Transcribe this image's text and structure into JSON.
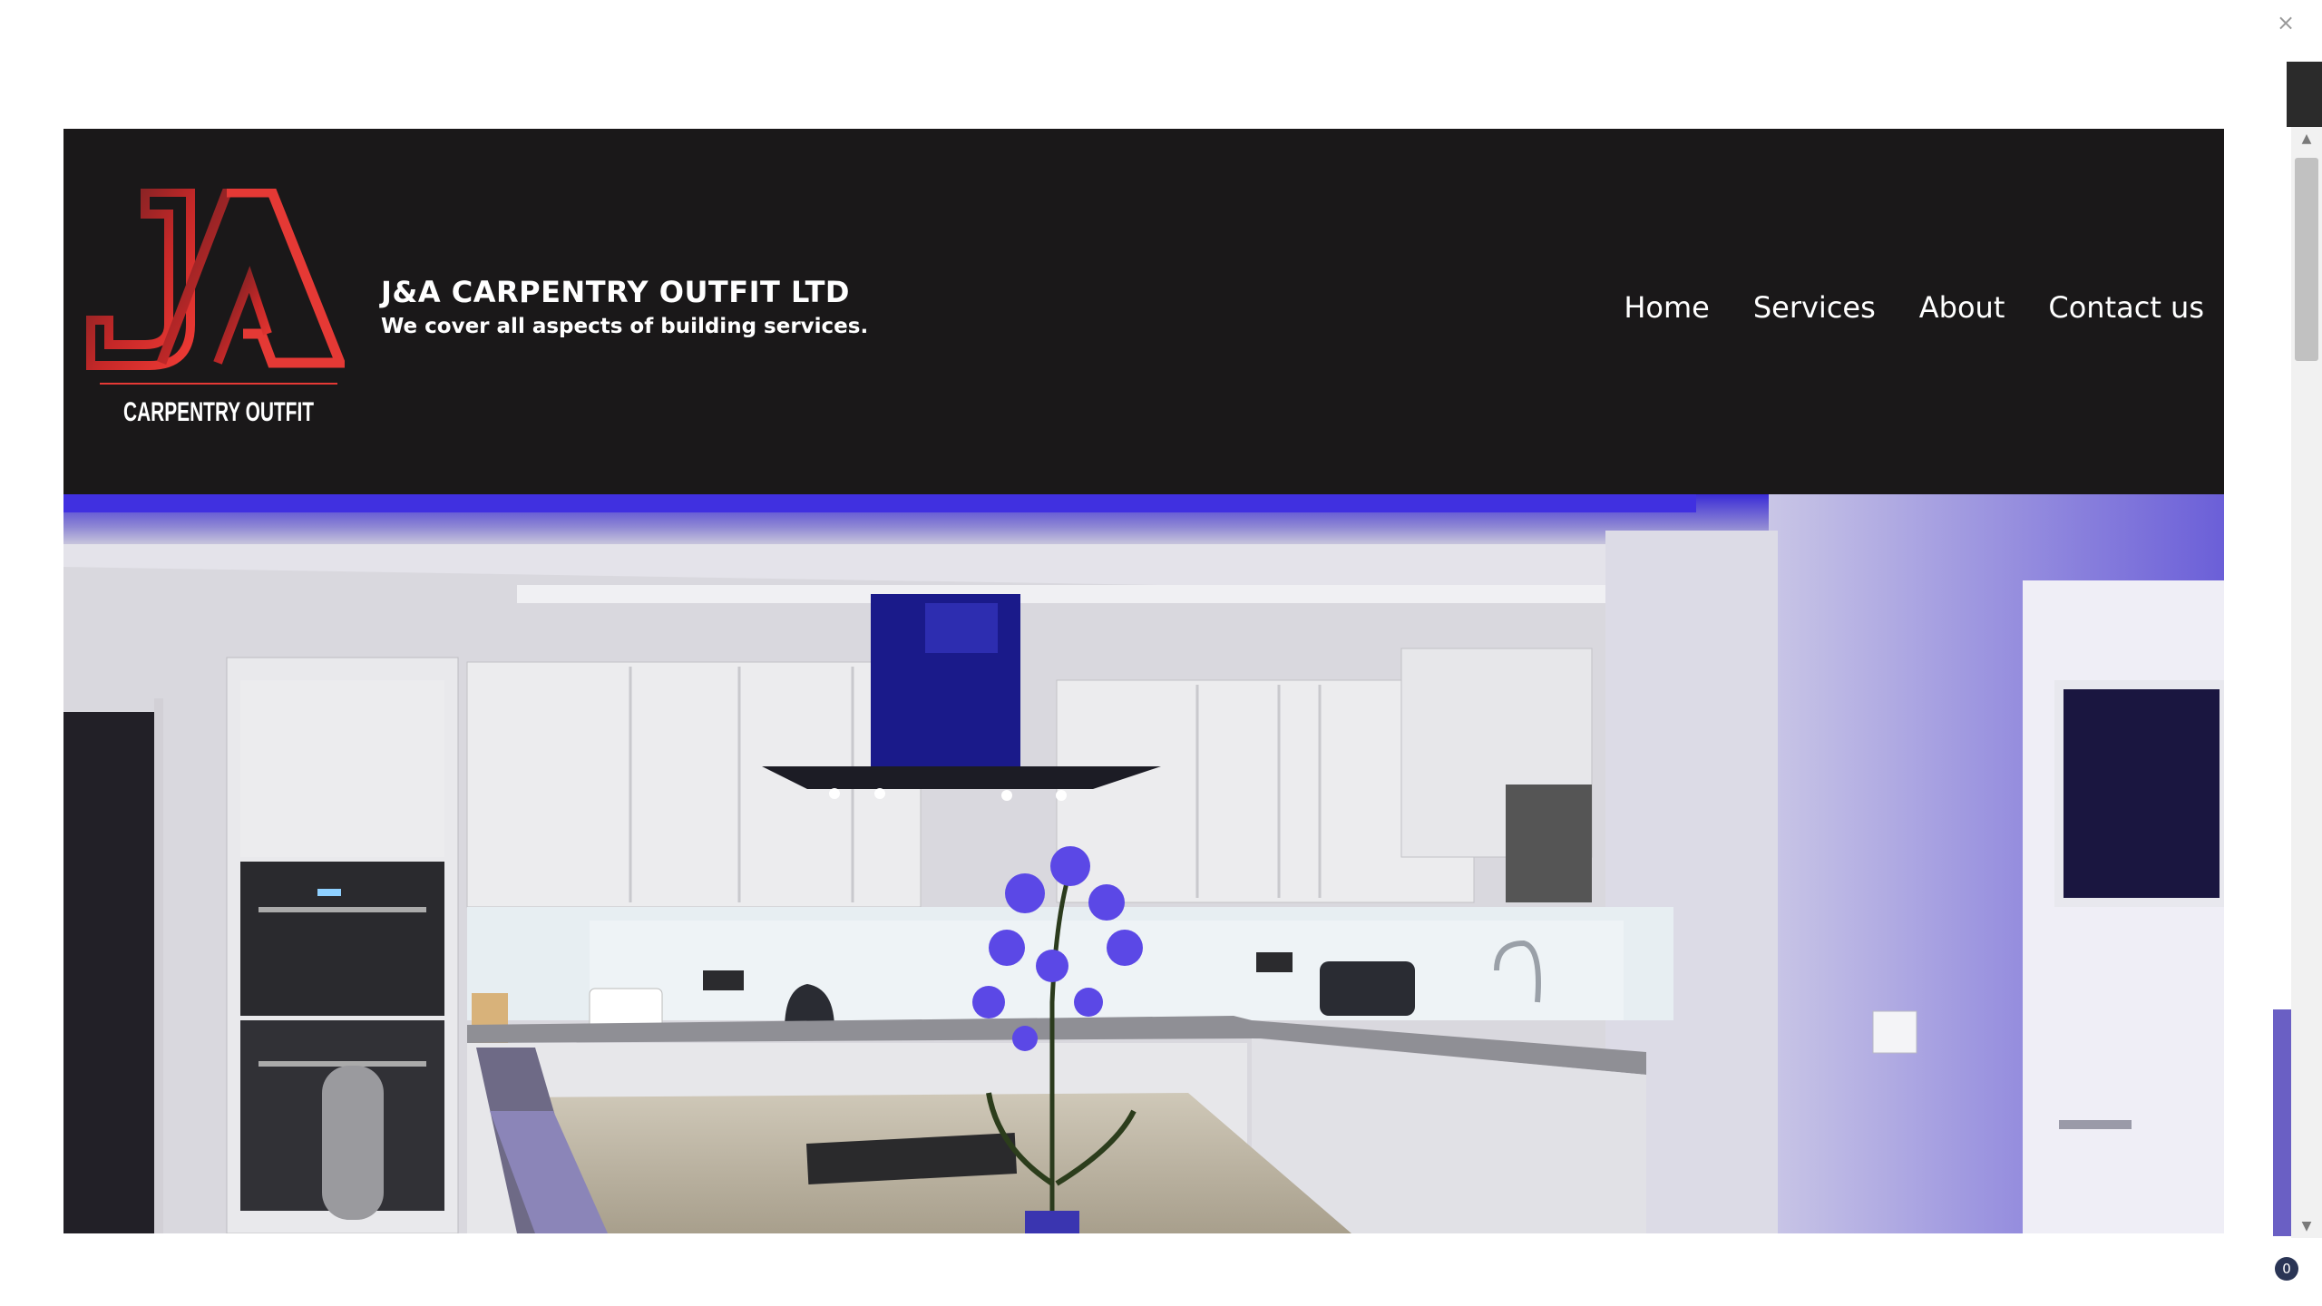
{
  "header": {
    "logo_text": "CARPENTRY OUTFIT",
    "logo_letters": "J/A",
    "brand_name": "J&A CARPENTRY OUTFIT LTD",
    "tagline": "We cover all aspects of building services."
  },
  "nav": {
    "items": [
      {
        "label": "Home"
      },
      {
        "label": "Services"
      },
      {
        "label": "About"
      },
      {
        "label": "Contact us"
      }
    ]
  },
  "hero": {
    "icon": "kitchen-photo"
  },
  "chrome": {
    "close_glyph": "×",
    "badge_text": "0",
    "scroll_up": "▲",
    "scroll_down": "▼"
  },
  "colors": {
    "header_bg": "#1a1819",
    "logo_red": "#e53935",
    "logo_dark_red": "#5a1f22",
    "accent_blue": "#3b2ee0"
  }
}
